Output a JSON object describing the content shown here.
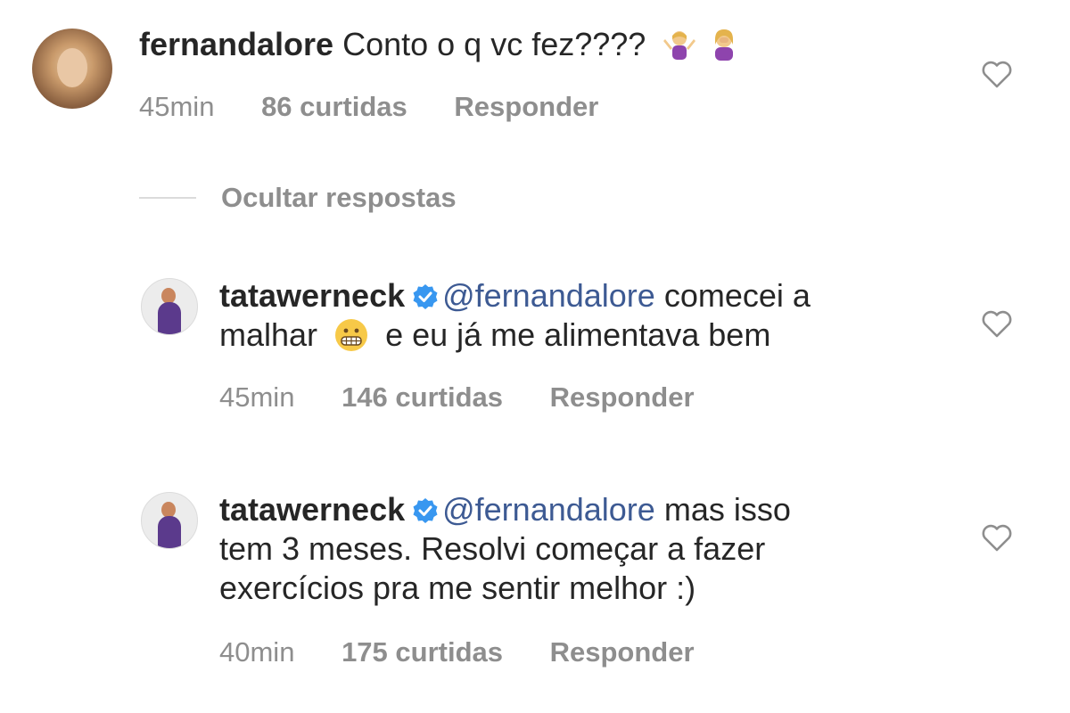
{
  "comment": {
    "username": "fernandalore",
    "text": "Conto o q vc fez????",
    "emoji_names": [
      "person-shrugging-emoji",
      "person-facepalming-emoji"
    ],
    "time": "45min",
    "likes": "86 curtidas",
    "reply_label": "Responder"
  },
  "replies_toggle": {
    "label": "Ocultar respostas"
  },
  "replies": [
    {
      "username": "tatawerneck",
      "mention": "@fernandalore",
      "text_a": "comecei a",
      "text_b": "malhar",
      "text_c": "e eu já me alimentava bem",
      "time": "45min",
      "likes": "146 curtidas",
      "reply_label": "Responder"
    },
    {
      "username": "tatawerneck",
      "mention": "@fernandalore",
      "text_a": "mas isso",
      "text_b": "tem 3 meses. Resolvi começar a fazer",
      "text_c": "exercícios pra me sentir melhor :)",
      "time": "40min",
      "likes": "175 curtidas",
      "reply_label": "Responder"
    }
  ],
  "colors": {
    "text": "#262626",
    "muted": "#8e8e8e",
    "mention": "#3d5a93",
    "verified": "#3897f0"
  },
  "icons": [
    "heart-outline-icon",
    "verified-badge-icon"
  ]
}
